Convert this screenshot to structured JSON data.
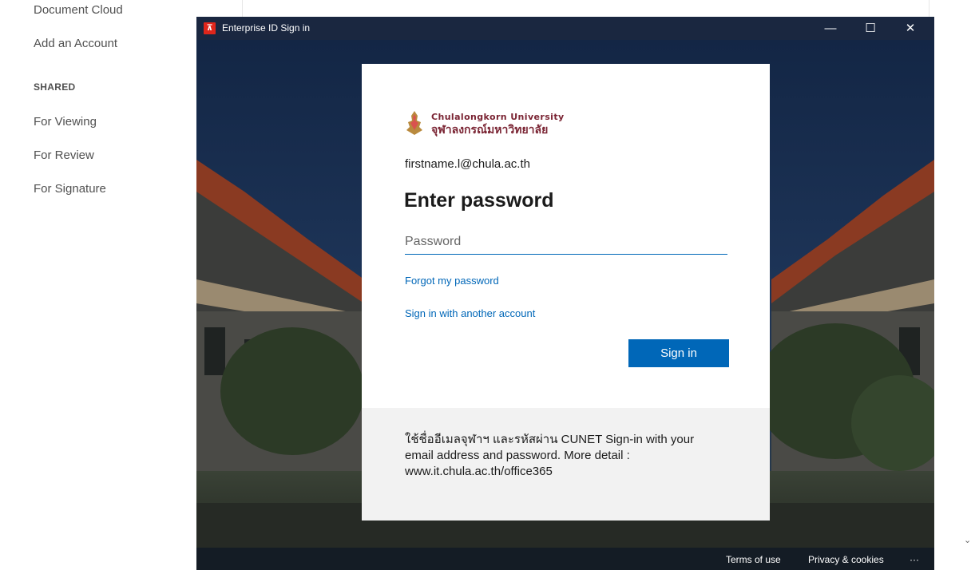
{
  "sidebar": {
    "top_item": "Document Cloud",
    "add_account": "Add an Account",
    "shared_heading": "SHARED",
    "items": [
      "For Viewing",
      "For Review",
      "For Signature"
    ]
  },
  "window": {
    "title": "Enterprise ID Sign in",
    "app_icon_glyph": "⊼",
    "minimize_glyph": "—",
    "maximize_glyph": "☐",
    "close_glyph": "✕"
  },
  "card": {
    "logo_en": "Chulalongkorn University",
    "logo_th": "จุฬาลงกรณ์มหาวิทยาลัย",
    "email": "firstname.l@chula.ac.th",
    "heading": "Enter password",
    "password_placeholder": "Password",
    "forgot_link": "Forgot my password",
    "other_account_link": "Sign in with another account",
    "sign_in_label": "Sign in",
    "footer_text": "ใช้ชื่ออีเมลจุฬาฯ และรหัสผ่าน CUNET Sign-in with your email address and password. More detail : www.it.chula.ac.th/office365"
  },
  "bottom_links": {
    "terms": "Terms of use",
    "privacy": "Privacy & cookies",
    "more": "···"
  },
  "colors": {
    "accent": "#0067b8",
    "logo": "#7a2433",
    "titlebar": "#1a2740"
  }
}
